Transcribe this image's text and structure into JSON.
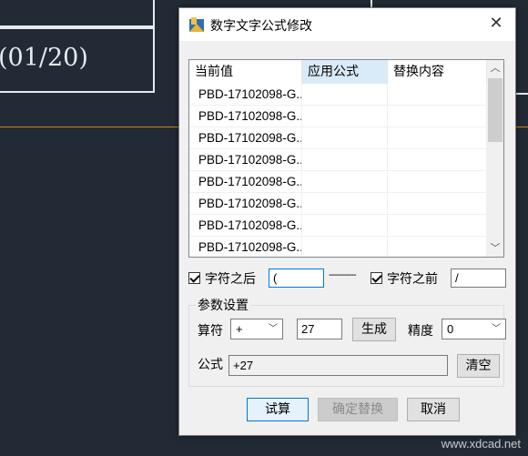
{
  "background": {
    "drawing_text": "(01/20)",
    "accent_line_color": "#c8881e"
  },
  "dialog": {
    "title": "数字文字公式修改",
    "close_glyph": "✕"
  },
  "list": {
    "columns": [
      "当前值",
      "应用公式",
      "替换内容"
    ],
    "rows": [
      {
        "current": "PBD-17102098-G...",
        "formula": "",
        "replace": ""
      },
      {
        "current": "PBD-17102098-G...",
        "formula": "",
        "replace": ""
      },
      {
        "current": "PBD-17102098-G...",
        "formula": "",
        "replace": ""
      },
      {
        "current": "PBD-17102098-G...",
        "formula": "",
        "replace": ""
      },
      {
        "current": "PBD-17102098-G...",
        "formula": "",
        "replace": ""
      },
      {
        "current": "PBD-17102098-G...",
        "formula": "",
        "replace": ""
      },
      {
        "current": "PBD-17102098-G...",
        "formula": "",
        "replace": ""
      },
      {
        "current": "PBD-17102098-G...",
        "formula": "",
        "replace": ""
      }
    ]
  },
  "after_char": {
    "label": "字符之后",
    "checked": true,
    "value": "("
  },
  "separator": "----------",
  "before_char": {
    "label": "字符之前",
    "checked": true,
    "value": "/"
  },
  "params": {
    "group_title": "参数设置",
    "operator_label": "算符",
    "operator_value": "+",
    "number_value": "27",
    "generate_label": "生成",
    "precision_label": "精度",
    "precision_value": "0",
    "formula_label": "公式",
    "formula_value": "+27",
    "clear_label": "清空"
  },
  "buttons": {
    "trial": "试算",
    "confirm_replace": "确定替换",
    "cancel": "取消"
  },
  "watermark": "www.xdcad.net"
}
